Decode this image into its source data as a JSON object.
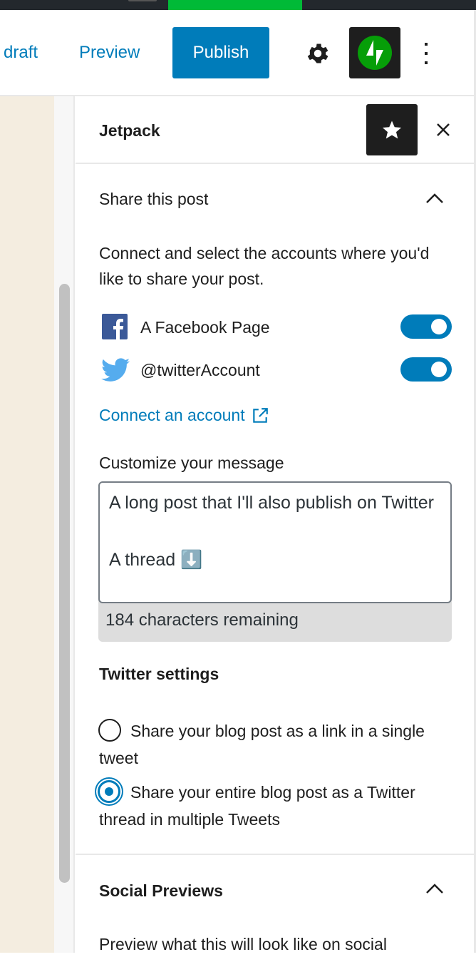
{
  "toolbar": {
    "save_draft_label": "draft",
    "preview_label": "Preview",
    "publish_label": "Publish"
  },
  "panel": {
    "title": "Jetpack"
  },
  "share": {
    "title": "Share this post",
    "description": "Connect and select the accounts where you'd like to share your post.",
    "accounts": [
      {
        "name": "A Facebook Page",
        "icon": "facebook-icon",
        "enabled": true
      },
      {
        "name": "@twitterAccount",
        "icon": "twitter-icon",
        "enabled": true
      }
    ],
    "connect_label": "Connect an account",
    "message_label": "Customize your message",
    "message_value": "A long post that I'll also publish on Twitter\n\nA thread ⬇️",
    "remaining": "184 characters remaining"
  },
  "twitter_settings": {
    "title": "Twitter settings",
    "options": [
      {
        "label": "Share your blog post as a link in a single tweet",
        "selected": false
      },
      {
        "label": "Share your entire blog post as a Twitter thread in multiple Tweets",
        "selected": true
      }
    ]
  },
  "social_previews": {
    "title": "Social Previews",
    "description": "Preview what this will look like on social"
  },
  "colors": {
    "accent": "#007cba",
    "jetpack_green": "#069e08",
    "toggle_on": "#007cba"
  }
}
